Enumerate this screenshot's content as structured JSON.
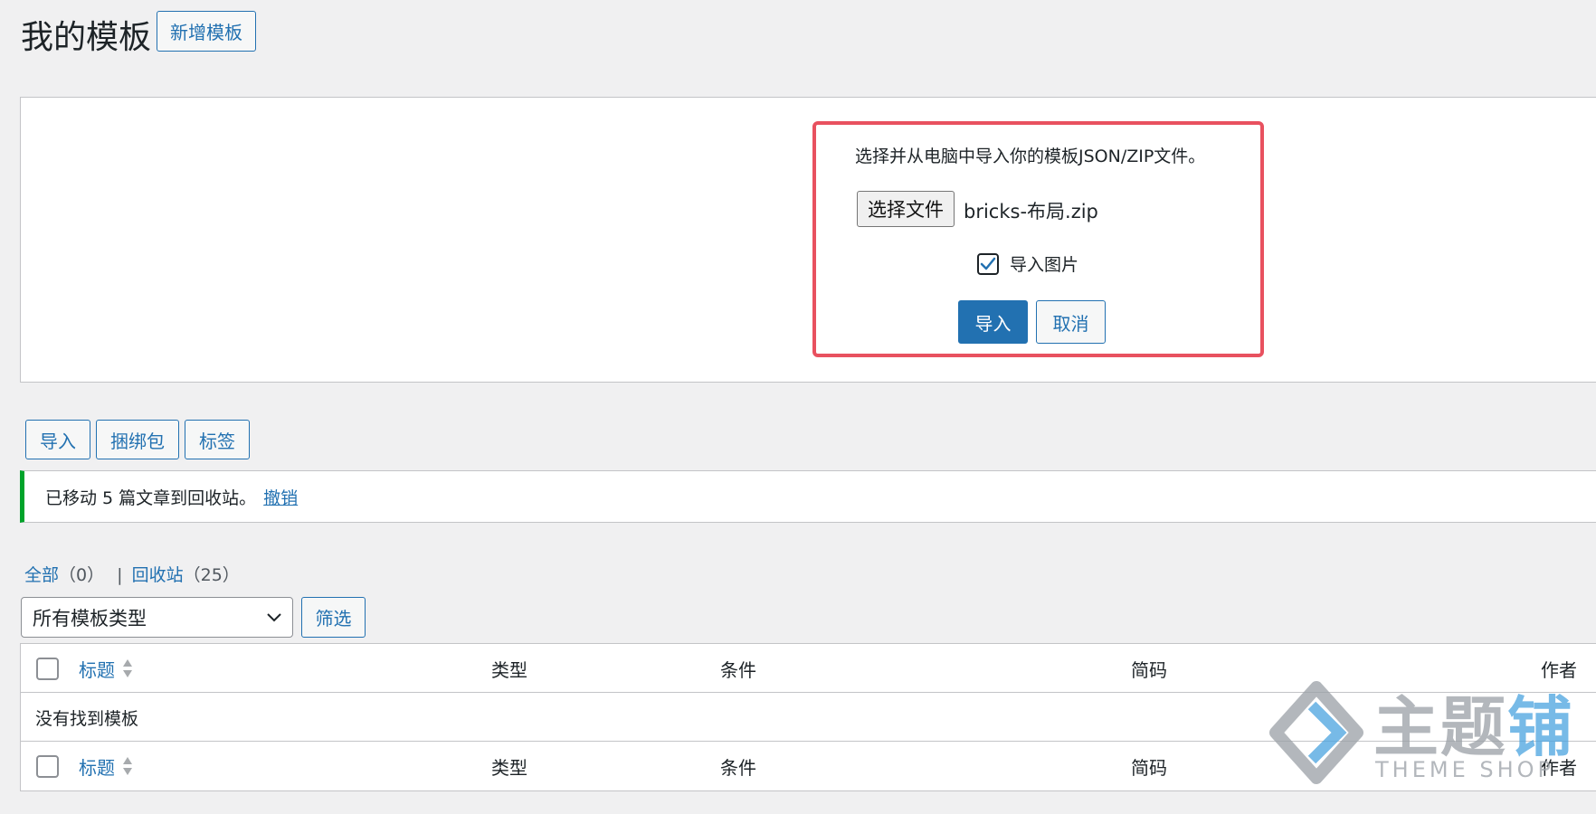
{
  "header": {
    "title": "我的模板",
    "add_new": "新增模板"
  },
  "import_panel": {
    "instruction": "选择并从电脑中导入你的模板JSON/ZIP文件。",
    "choose_file": "选择文件",
    "file_name": "bricks-布局.zip",
    "import_images_label": "导入图片",
    "import_images_checked": true,
    "import_button": "导入",
    "cancel_button": "取消"
  },
  "actions": {
    "import": "导入",
    "bundles": "捆绑包",
    "tags": "标签"
  },
  "notice": {
    "text": "已移动 5 篇文章到回收站。",
    "undo": "撤销"
  },
  "views": {
    "all_label": "全部",
    "all_count": "（0）",
    "separator": "|",
    "trash_label": "回收站",
    "trash_count": "（25）"
  },
  "filter": {
    "select_value": "所有模板类型",
    "filter_button": "筛选"
  },
  "table": {
    "columns": {
      "title": "标题",
      "type": "类型",
      "conditions": "条件",
      "shortcode": "简码",
      "author": "作者"
    },
    "empty_message": "没有找到模板"
  },
  "watermark": {
    "brand_gray": "主题",
    "brand_accent": "铺",
    "sub": "THEME SHOP"
  },
  "colors": {
    "accent": "#2271b1",
    "highlight_border": "#e8515f",
    "notice_success": "#00a32a",
    "background": "#f0f0f1"
  }
}
